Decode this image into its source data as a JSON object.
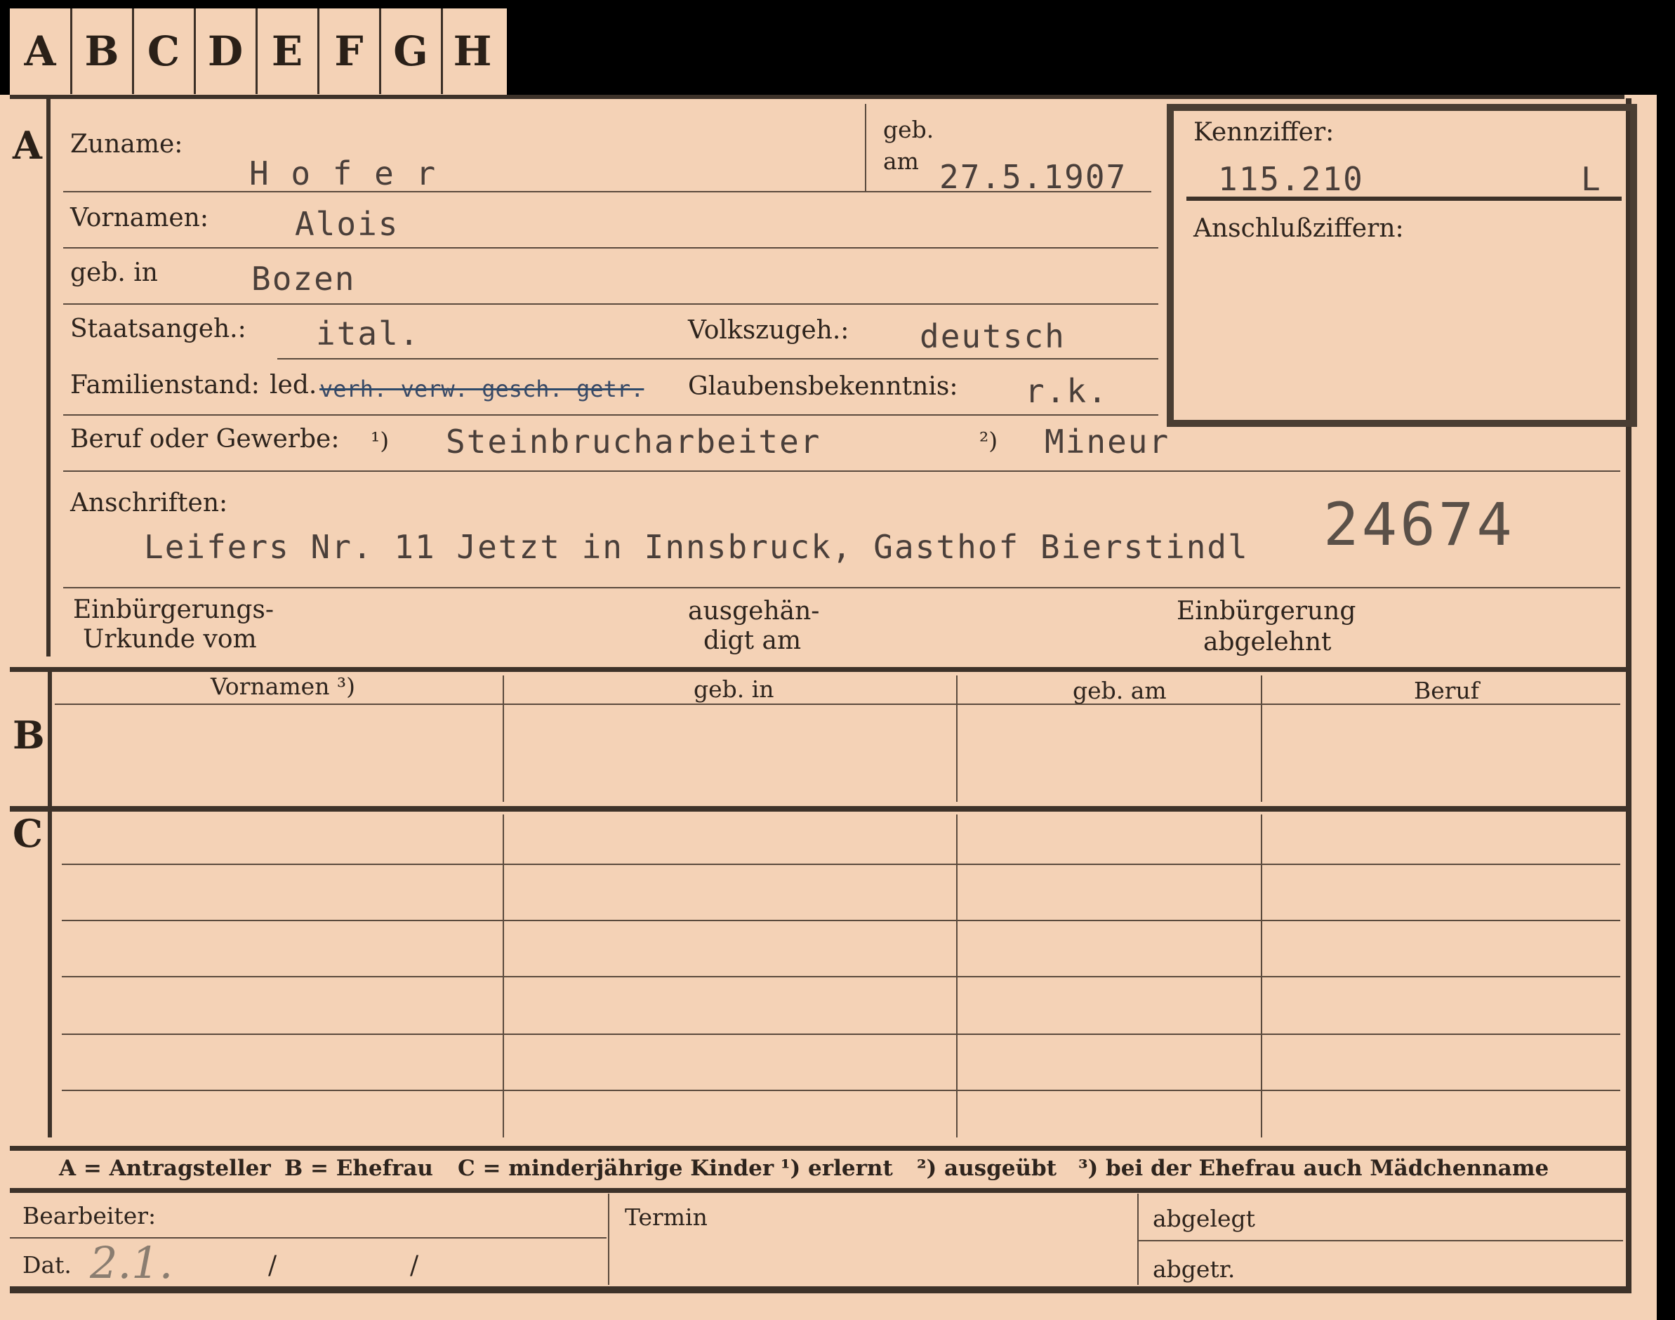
{
  "tabs": [
    "A",
    "B",
    "C",
    "D",
    "E",
    "F",
    "G",
    "H"
  ],
  "sections": {
    "a": "A",
    "b": "B",
    "c": "C"
  },
  "header": {
    "zuname_label": "Zuname:",
    "zuname_value": "H o f e r",
    "geb_label": "geb.",
    "am_label": "am",
    "geb_date": "27.5.1907",
    "kennziffer_label": "Kennziffer:",
    "kennziffer_value": "115.210",
    "kennziffer_letter": "L",
    "anschluss_label": "Anschlußziffern:"
  },
  "person": {
    "vornamen_label": "Vornamen:",
    "vornamen_value": "Alois",
    "gebin_label": "geb. in",
    "gebin_value": "Bozen",
    "staat_label": "Staatsangeh.:",
    "staat_value": "ital.",
    "volks_label": "Volkszugeh.:",
    "volks_value": "deutsch",
    "familien_label": "Familienstand:",
    "familien_led": "led.",
    "familien_struck": "verh. verw. gesch. getr.",
    "glauben_label": "Glaubensbekenntnis:",
    "glauben_value": "r.k.",
    "beruf_label": "Beruf oder Gewerbe:",
    "beruf_note1": "¹)",
    "beruf_value1": "Steinbrucharbeiter",
    "beruf_note2": "²)",
    "beruf_value2": "Mineur",
    "anschriften_label": "Anschriften:",
    "anschriften_value": "Leifers Nr. 11 Jetzt in Innsbruck, Gasthof Bierstindl",
    "stamp_number": "24674",
    "einb_label1": "Einbürgerungs-",
    "einb_label2": "Urkunde vom",
    "ausg_label1": "ausgehän-",
    "ausg_label2": "digt am",
    "abgelehnt_label1": "Einbürgerung",
    "abgelehnt_label2": "abgelehnt"
  },
  "table_b": {
    "headers": [
      "Vornamen ³)",
      "geb. in",
      "geb. am",
      "Beruf"
    ]
  },
  "legend": {
    "a": "A = Antragsteller",
    "b": "B = Ehefrau",
    "c": "C = minderjährige Kinder",
    "n1": "¹) erlernt",
    "n2": "²) ausgeübt",
    "n3": "³) bei der Ehefrau auch Mädchenname"
  },
  "footer": {
    "bearbeiter_label": "Bearbeiter:",
    "dat_label": "Dat.",
    "dat_value": "2.1.",
    "slash1": "/",
    "slash2": "/",
    "termin_label": "Termin",
    "abgelegt_label": "abgelegt",
    "abgetr_label": "abgetr."
  },
  "colors": {
    "card": "#f4d2b6",
    "ink": "#2a1f18",
    "typewriter": "#4a3f3a"
  }
}
